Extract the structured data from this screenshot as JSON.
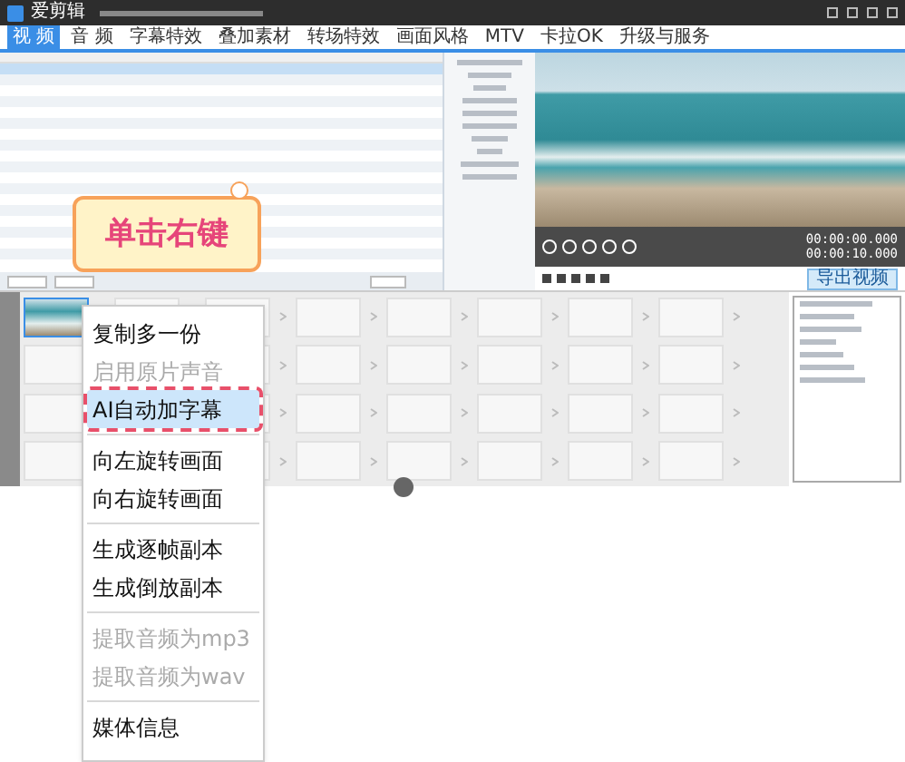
{
  "window": {
    "title": "爱剪辑"
  },
  "tabs": [
    {
      "label": "视 频",
      "selected": true
    },
    {
      "label": "音 频",
      "selected": false
    },
    {
      "label": "字幕特效",
      "selected": false
    },
    {
      "label": "叠加素材",
      "selected": false
    },
    {
      "label": "转场特效",
      "selected": false
    },
    {
      "label": "画面风格",
      "selected": false
    },
    {
      "label": "MTV",
      "selected": false
    },
    {
      "label": "卡拉OK",
      "selected": false
    },
    {
      "label": "升级与服务",
      "selected": false
    }
  ],
  "clip_table": {
    "rows": [
      {
        "selected": true
      }
    ]
  },
  "sticker": "单击右键",
  "player": {
    "time_current": "00:00:00.000",
    "time_total": "00:00:10.000",
    "export": "导出视频"
  },
  "context_menu": [
    {
      "kind": "item",
      "label": "复制多一份",
      "disabled": false,
      "selected": false
    },
    {
      "kind": "item",
      "label": "启用原片声音",
      "disabled": true,
      "selected": false
    },
    {
      "kind": "item",
      "label": "AI自动加字幕",
      "disabled": false,
      "selected": true
    },
    {
      "kind": "separator"
    },
    {
      "kind": "item",
      "label": "向左旋转画面",
      "disabled": false,
      "selected": false
    },
    {
      "kind": "item",
      "label": "向右旋转画面",
      "disabled": false,
      "selected": false
    },
    {
      "kind": "separator"
    },
    {
      "kind": "item",
      "label": "生成逐帧副本",
      "disabled": false,
      "selected": false
    },
    {
      "kind": "item",
      "label": "生成倒放副本",
      "disabled": false,
      "selected": false
    },
    {
      "kind": "separator"
    },
    {
      "kind": "item",
      "label": "提取音频为mp3",
      "disabled": true,
      "selected": false
    },
    {
      "kind": "item",
      "label": "提取音频为wav",
      "disabled": true,
      "selected": false
    },
    {
      "kind": "separator"
    },
    {
      "kind": "item",
      "label": "媒体信息",
      "disabled": false,
      "selected": false
    }
  ]
}
